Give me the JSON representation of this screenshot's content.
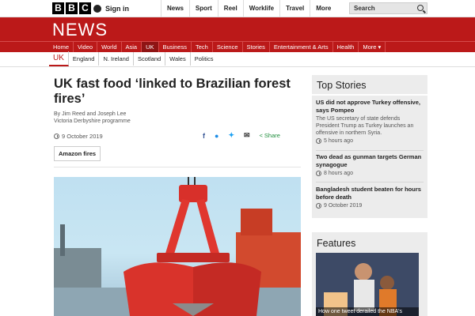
{
  "topbar": {
    "logo_letters": [
      "B",
      "B",
      "C"
    ],
    "signin_label": "Sign in",
    "nav": [
      "News",
      "Sport",
      "Reel",
      "Worklife",
      "Travel"
    ],
    "more_label": "More",
    "search_placeholder": "Search"
  },
  "masthead": {
    "title": "NEWS"
  },
  "main_nav": {
    "items": [
      "Home",
      "Video",
      "World",
      "Asia",
      "UK",
      "Business",
      "Tech",
      "Science",
      "Stories",
      "Entertainment & Arts",
      "Health",
      "More ▾"
    ],
    "active": "UK"
  },
  "sub_nav": {
    "items": [
      "UK",
      "England",
      "N. Ireland",
      "Scotland",
      "Wales",
      "Politics"
    ],
    "active": "UK"
  },
  "article": {
    "headline": "UK fast food ‘linked to Brazilian forest fires’",
    "byline_authors": "By Jim Reed and Joseph Lee",
    "byline_programme": "Victoria Derbyshire programme",
    "date": "9 October 2019",
    "share_label": "Share",
    "tag": "Amazon fires"
  },
  "top_stories": {
    "title": "Top Stories",
    "items": [
      {
        "headline": "US did not approve Turkey offensive, says Pompeo",
        "summary": "The US secretary of state defends President Trump as Turkey launches an offensive in northern Syria.",
        "time": "5 hours ago"
      },
      {
        "headline": "Two dead as gunman targets German synagogue",
        "summary": "",
        "time": "8 hours ago"
      },
      {
        "headline": "Bangladesh student beaten for hours before death",
        "summary": "",
        "time": "9 October 2019"
      }
    ]
  },
  "features": {
    "title": "Features",
    "caption": "How one tweet derailed the NBA's"
  },
  "colors": {
    "brand_red": "#bb1919",
    "sidebar_bg": "#ececec"
  }
}
